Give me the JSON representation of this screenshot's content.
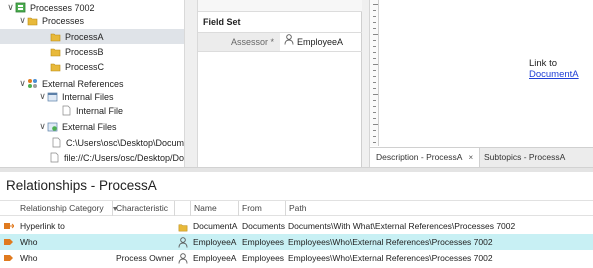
{
  "tree": {
    "items": [
      {
        "label": "Processes 7002",
        "level": 0,
        "chevron": "∨",
        "icon": "process-model-icon"
      },
      {
        "label": "Processes",
        "level": 1,
        "chevron": "∨",
        "icon": "folder-icon"
      },
      {
        "label": "ProcessA",
        "level": 2,
        "chevron": "",
        "icon": "folder-icon",
        "selected": true
      },
      {
        "label": "ProcessB",
        "level": 2,
        "chevron": "",
        "icon": "folder-icon"
      },
      {
        "label": "ProcessC",
        "level": 2,
        "chevron": "",
        "icon": "folder-icon"
      },
      {
        "label": "External References",
        "level": 1,
        "chevron": "∨",
        "icon": "external-references-icon"
      },
      {
        "label": "Internal Files",
        "level": 2,
        "chevron": "∨",
        "icon": "internal-files-icon"
      },
      {
        "label": "Internal File",
        "level": 3,
        "chevron": "",
        "icon": "file-icon"
      },
      {
        "label": "External Files",
        "level": 2,
        "chevron": "∨",
        "icon": "external-files-icon"
      },
      {
        "label": "C:\\Users\\osc\\Desktop\\Docum",
        "level": 3,
        "chevron": "",
        "icon": "file-icon"
      },
      {
        "label": "file://C:/Users/osc/Desktop/Do",
        "level": 3,
        "chevron": "",
        "icon": "file-icon"
      }
    ]
  },
  "fieldset": {
    "title": "Field Set",
    "field_label": "Assessor *",
    "field_value": "EmployeeA"
  },
  "description": {
    "link_prefix": "Link to ",
    "link_text": "DocumentA",
    "tabs": [
      {
        "label": "Description - ProcessA",
        "close": "×",
        "active": true
      },
      {
        "label": "Subtopics - ProcessA",
        "active": false
      }
    ]
  },
  "relationships": {
    "title": "Relationships - ProcessA",
    "columns": {
      "category": "Relationship Category",
      "characteristic": "Characteristic",
      "name": "Name",
      "from": "From",
      "path": "Path"
    },
    "rows": [
      {
        "category": "Hyperlink to",
        "characteristic": "",
        "name": "DocumentA",
        "from": "Documents",
        "path": "Documents\\With What\\External References\\Processes 7002",
        "row_icon": "hyperlink-icon",
        "name_icon": "folder-icon",
        "selected": false
      },
      {
        "category": "Who",
        "characteristic": "",
        "name": "EmployeeA",
        "from": "Employees",
        "path": "Employees\\Who\\External References\\Processes 7002",
        "row_icon": "who-icon",
        "name_icon": "person-icon",
        "selected": true
      },
      {
        "category": "Who",
        "characteristic": "Process Owner",
        "name": "EmployeeA",
        "from": "Employees",
        "path": "Employees\\Who\\External References\\Processes 7002",
        "row_icon": "who-icon",
        "name_icon": "person-icon",
        "selected": false
      }
    ]
  },
  "colors": {
    "selection": "#c8f0f4",
    "tree_selection": "#dfe3e8",
    "link": "#1f3fd6",
    "folder": "#e8b93a",
    "accent_orange": "#e07a1f"
  }
}
